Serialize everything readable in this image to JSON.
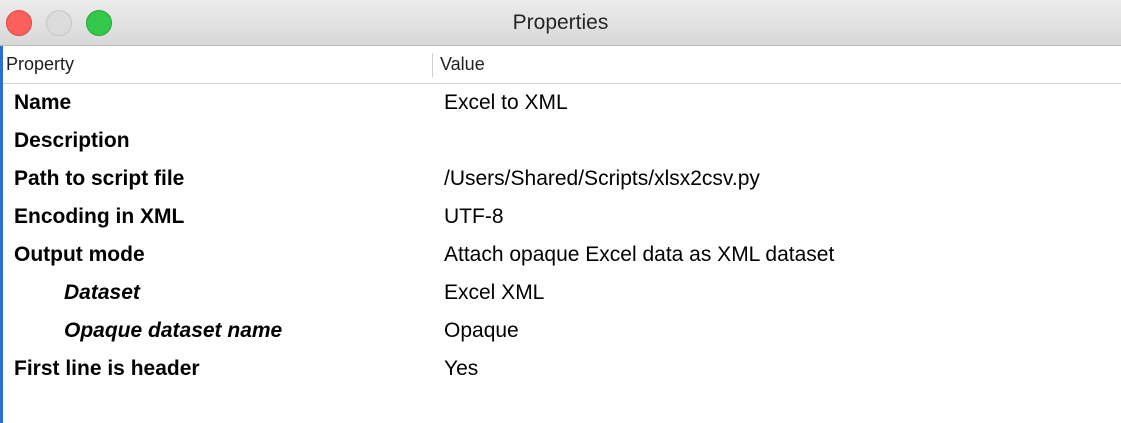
{
  "window": {
    "title": "Properties"
  },
  "table": {
    "headers": {
      "property": "Property",
      "value": "Value"
    },
    "rows": [
      {
        "property": "Name",
        "value": "Excel to XML"
      },
      {
        "property": "Description",
        "value": ""
      },
      {
        "property": "Path to script file",
        "value": "/Users/Shared/Scripts/xlsx2csv.py"
      },
      {
        "property": "Encoding in XML",
        "value": "UTF-8"
      },
      {
        "property": "Output mode",
        "value": "Attach opaque Excel data as XML dataset"
      },
      {
        "property": "Dataset",
        "value": "Excel XML"
      },
      {
        "property": "Opaque dataset name",
        "value": "Opaque"
      },
      {
        "property": "First line is header",
        "value": "Yes"
      }
    ]
  },
  "colors": {
    "close": "#fc605c",
    "minimize": "#dcdcdc",
    "zoom": "#34c84a",
    "focus_border": "#2a6fd6"
  }
}
